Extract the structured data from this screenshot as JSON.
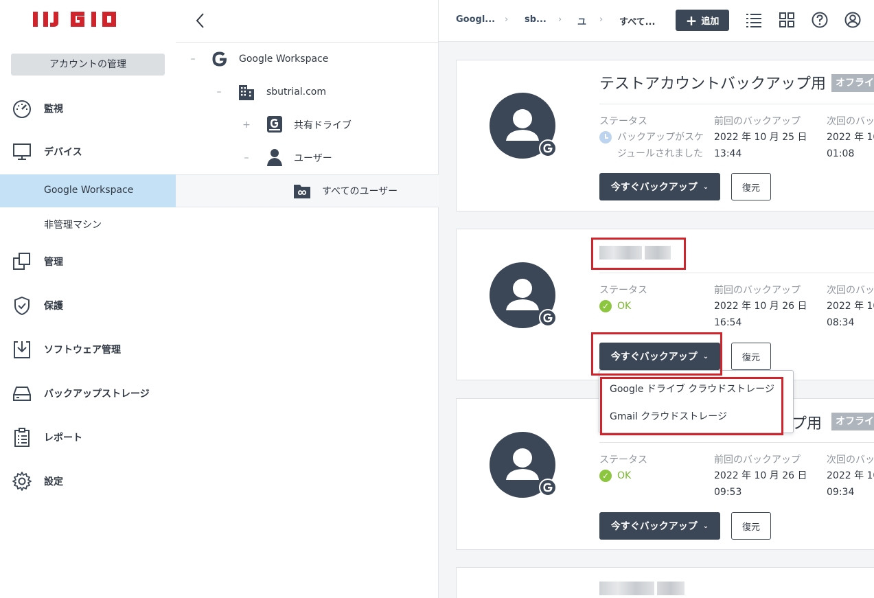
{
  "brand": {
    "logo_text": "IIJ GIO",
    "accent": "#d0232c"
  },
  "sidebar": {
    "account_button": "アカウントの管理",
    "items": [
      {
        "label": "監視",
        "icon": "gauge-icon"
      },
      {
        "label": "デバイス",
        "icon": "monitor-icon"
      },
      {
        "label": "Google Workspace",
        "sub": true,
        "active": true
      },
      {
        "label": "非管理マシン",
        "sub": true
      },
      {
        "label": "管理",
        "icon": "copy-icon"
      },
      {
        "label": "保護",
        "icon": "shield-icon"
      },
      {
        "label": "ソフトウェア管理",
        "icon": "download-tray-icon"
      },
      {
        "label": "バックアップストレージ",
        "icon": "drive-icon"
      },
      {
        "label": "レポート",
        "icon": "clipboard-icon"
      },
      {
        "label": "設定",
        "icon": "gear-icon"
      }
    ]
  },
  "tree": {
    "nodes": [
      {
        "label": "Google Workspace",
        "toggle": "–",
        "icon": "google-icon"
      },
      {
        "label": "sbutrial.com",
        "toggle": "–",
        "icon": "building-icon"
      },
      {
        "label": "共有ドライブ",
        "toggle": "+",
        "icon": "shared-drive-icon"
      },
      {
        "label": "ユーザー",
        "toggle": "–",
        "icon": "user-icon"
      },
      {
        "label": "すべてのユーザー",
        "icon": "infinity-folder-icon"
      }
    ]
  },
  "topbar": {
    "breadcrumbs": [
      "Googl...",
      "sb...",
      "ユ",
      "すべて..."
    ],
    "add_button": "追加"
  },
  "cards": [
    {
      "name": "テストアカウントバックアップ用",
      "badge": "オフライ",
      "status_label": "ステータス",
      "status": "バックアップがスケジュールされました",
      "status_line1": "バックアップがスケ",
      "status_line2": "ジュールされました",
      "last_label": "前回のバックアップ",
      "last_date": "2022 年 10 月 25 日",
      "last_time": "13:44",
      "next_label": "次回のバッ",
      "next_date": "2022 年 10",
      "next_time": "01:08",
      "backup_button": "今すぐバックアップ",
      "restore_button": "復元"
    },
    {
      "status_label": "ステータス",
      "status": "OK",
      "last_label": "前回のバックアップ",
      "last_date": "2022 年 10 月 26 日",
      "last_time": "16:54",
      "next_label": "次回のバッ",
      "next_date": "2022 年 10",
      "next_time": "08:34",
      "backup_button": "今すぐバックアップ",
      "restore_button": "復元"
    },
    {
      "name_tail": "プ用",
      "badge": "オフライ",
      "status_label": "ステータス",
      "status": "OK",
      "last_label": "前回のバックアップ",
      "last_date": "2022 年 10 月 26 日",
      "last_time": "09:53",
      "next_label": "次回のバッ",
      "next_date": "2022 年 10",
      "next_time": "09:34",
      "backup_button": "今すぐバックアップ",
      "restore_button": "復元"
    }
  ],
  "dropdown": {
    "items": [
      "Google ドライブ クラウドストレージ",
      "Gmail クラウドストレージ"
    ]
  }
}
